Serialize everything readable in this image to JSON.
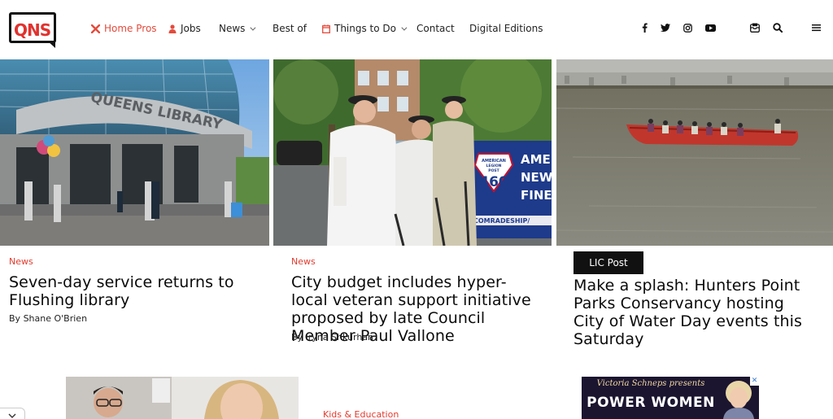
{
  "header": {
    "logo_text": "QNS",
    "nav": [
      {
        "label": "Home Pros",
        "icon": "tools-icon"
      },
      {
        "label": "Jobs",
        "icon": "person-icon"
      },
      {
        "label": "News",
        "icon": "chevron-down-icon"
      },
      {
        "label": "Best of"
      },
      {
        "label": "Things to Do",
        "icon": "calendar-icon"
      },
      {
        "label": "Contact"
      },
      {
        "label": "Digital Editions"
      }
    ],
    "social_icons": [
      "facebook-icon",
      "twitter-icon",
      "instagram-icon",
      "youtube-icon"
    ],
    "utility_icons": [
      "newsletter-icon",
      "search-icon",
      "menu-icon"
    ]
  },
  "articles": [
    {
      "category": "News",
      "headline": "Seven-day service returns to Flushing library",
      "byline_prefix": "By",
      "author": "Shane O'Brien",
      "image_text": "QUEENS LIBRARY"
    },
    {
      "category": "News",
      "headline": "City budget includes hyper-local veteran support initiative proposed by late Council Member Paul Vallone",
      "byline_prefix": "By",
      "author": "Iryna Shkurhan",
      "banner_text": [
        "AMERICAN",
        "LEGION",
        "POST",
        "460",
        "AME",
        "NEW",
        "FINE",
        "COMRADESHIP/"
      ]
    },
    {
      "badge": "LIC Post",
      "headline": "Make a splash: Hunters Point Parks Conservancy hosting City of Water Day events this Saturday"
    }
  ],
  "bottom": {
    "category": "Kids & Education",
    "ad_line1": "Victoria Schneps presents",
    "ad_line2": "POWER WOMEN"
  },
  "colors": {
    "accent": "#e34b3c",
    "category_red": "#e03b2f",
    "badge_bg": "#111111"
  }
}
